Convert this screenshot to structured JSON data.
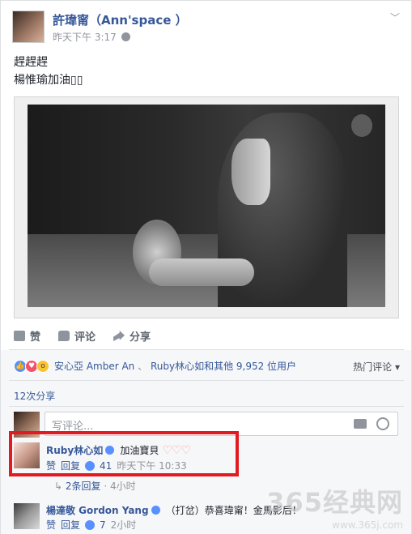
{
  "post": {
    "author": "許瑋甯（Ann'space ）",
    "timestamp": "昨天下午 3:17",
    "text_line1": "趕趕趕",
    "text_line2": "楊惟瑜加油▯▯"
  },
  "actions": {
    "like": "赞",
    "comment": "评论",
    "share": "分享"
  },
  "reactions": {
    "names_a": "安心亞 Amber An",
    "separator": "、",
    "names_b": "Ruby林心如和其他 9,952 位用户",
    "sort_label": "热门评论",
    "icons": [
      "like-icon",
      "love-icon",
      "wow-icon"
    ]
  },
  "shares": "12次分享",
  "composer": {
    "placeholder": "写评论..."
  },
  "comments": [
    {
      "name": "Ruby林心如",
      "text": "加油寶貝",
      "hearts": "♡♡♡",
      "reply_label": "回复",
      "like_label": "赞",
      "likes": "41",
      "time": "昨天下午 10:33"
    },
    {
      "name": "楊達敬 Gordon Yang",
      "text": "（打岔）恭喜瑋甯！金馬影后！",
      "reply_label": "回复",
      "like_label": "赞",
      "likes": "7",
      "time": "2小时"
    }
  ],
  "replies": {
    "label": "2条回复",
    "time": "4小时"
  },
  "watermark": {
    "line1": "365经典网",
    "line2": "www.365j.com"
  },
  "colors": {
    "link": "#365899",
    "highlight": "#e21a21"
  }
}
